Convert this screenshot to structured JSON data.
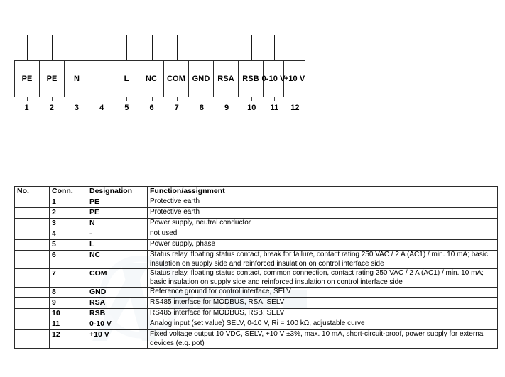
{
  "terminal_block": {
    "cells": [
      {
        "pin": "1",
        "label": "PE",
        "wire": true
      },
      {
        "pin": "2",
        "label": "PE",
        "wire": true
      },
      {
        "pin": "3",
        "label": "N",
        "wire": true
      },
      {
        "pin": "4",
        "label": "",
        "wire": false
      },
      {
        "pin": "5",
        "label": "L",
        "wire": true
      },
      {
        "pin": "6",
        "label": "NC",
        "wire": true
      },
      {
        "pin": "7",
        "label": "COM",
        "wire": true
      },
      {
        "pin": "8",
        "label": "GND",
        "wire": true
      },
      {
        "pin": "9",
        "label": "RSA",
        "wire": true
      },
      {
        "pin": "10",
        "label": "RSB",
        "wire": true
      },
      {
        "pin": "11",
        "label": "0-10 V",
        "wire": true
      },
      {
        "pin": "12",
        "label": "+10 V",
        "wire": true
      }
    ]
  },
  "pin_table": {
    "headers": {
      "no": "No.",
      "conn": "Conn.",
      "designation": "Designation",
      "function": "Function/assignment"
    },
    "rows": [
      {
        "no": "",
        "conn": "1",
        "designation": "PE",
        "function": "Protective earth"
      },
      {
        "no": "",
        "conn": "2",
        "designation": "PE",
        "function": "Protective earth"
      },
      {
        "no": "",
        "conn": "3",
        "designation": "N",
        "function": "Power supply, neutral conductor"
      },
      {
        "no": "",
        "conn": "4",
        "designation": "-",
        "function": "not used"
      },
      {
        "no": "",
        "conn": "5",
        "designation": "L",
        "function": "Power supply, phase"
      },
      {
        "no": "",
        "conn": "6",
        "designation": "NC",
        "function": "Status relay, floating status contact, break for failure, contact rating 250 VAC / 2 A (AC1) / min. 10 mA; basic insulation on supply side and reinforced insulation on control interface side"
      },
      {
        "no": "",
        "conn": "7",
        "designation": "COM",
        "function": "Status relay, floating status contact, common connection, contact rating 250 VAC / 2 A (AC1) / min. 10 mA; basic insulation on supply side and reinforced insulation on control interface side"
      },
      {
        "no": "",
        "conn": "8",
        "designation": "GND",
        "function": "Reference ground for control interface, SELV"
      },
      {
        "no": "",
        "conn": "9",
        "designation": "RSA",
        "function": "RS485 interface for MODBUS, RSA; SELV"
      },
      {
        "no": "",
        "conn": "10",
        "designation": "RSB",
        "function": "RS485 interface for MODBUS, RSB; SELV"
      },
      {
        "no": "",
        "conn": "11",
        "designation": "0-10 V",
        "function": "Analog input (set value) SELV, 0-10 V, Ri = 100 kΩ, adjustable curve"
      },
      {
        "no": "",
        "conn": "12",
        "designation": "+10 V",
        "function": "Fixed voltage output 10 VDC, SELV, +10 V ±3%, max. 10 mA, short-circuit-proof, power supply for external devices (e.g. pot)"
      }
    ]
  },
  "colors": {
    "line": "#2b2b2b",
    "text": "#000000",
    "watermark": "#aebfd0"
  }
}
